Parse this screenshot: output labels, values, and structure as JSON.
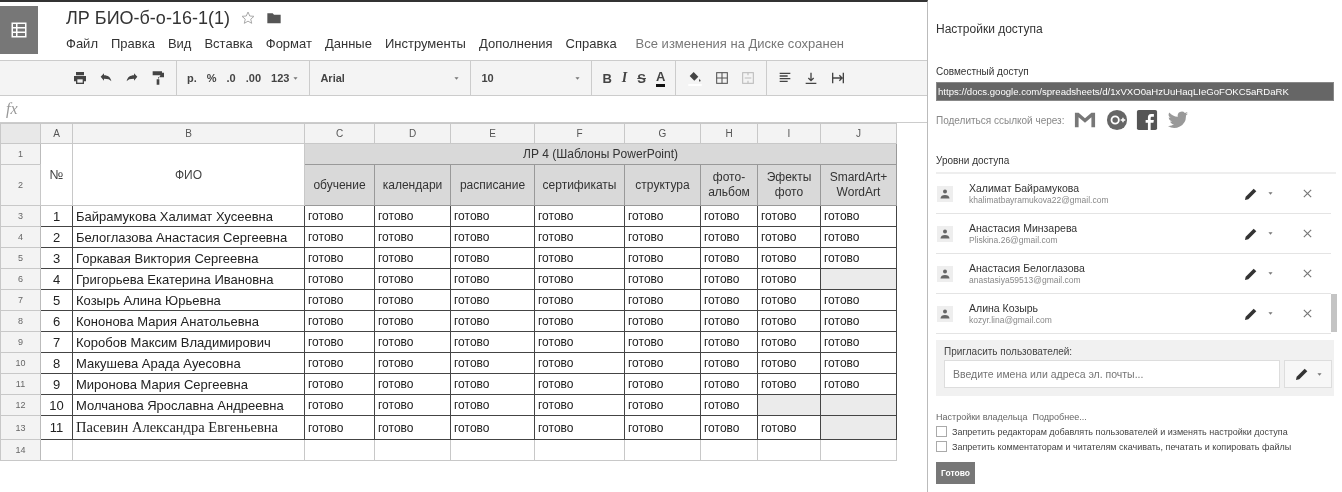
{
  "sheet": {
    "title": "ЛР БИО-б-о-16-1(1)",
    "menu": [
      "Файл",
      "Правка",
      "Вид",
      "Вставка",
      "Формат",
      "Данные",
      "Инструменты",
      "Дополнения",
      "Справка"
    ],
    "save_status": "Все изменения на Диске сохранен",
    "toolbar": {
      "currency": "р.",
      "percent": "%",
      "decimal_less": ".0",
      "decimal_more": ".00",
      "number_format": "123",
      "font": "Arial",
      "font_size": "10",
      "bold": "B",
      "italic": "I",
      "strike": "S",
      "text_color": "A"
    },
    "formula_label": "fx",
    "columns": [
      "A",
      "B",
      "C",
      "D",
      "E",
      "F",
      "G",
      "H",
      "I",
      "J"
    ],
    "header": {
      "row_numbers": [
        "1",
        "2"
      ],
      "number": "№",
      "name": "ФИО",
      "group": "ЛР 4 (Шаблоны PowerPoint)",
      "subcolumns": [
        "обучение",
        "календари",
        "расписание",
        "сертификаты",
        "структура",
        "фото-альбом",
        "Эфекты фото",
        "SmardArt+ WordArt"
      ]
    },
    "rows": [
      {
        "row_number": "3",
        "number": "1",
        "name": "Байрамукова Халимат Хусеевна",
        "cells": [
          "готово",
          "готово",
          "готово",
          "готово",
          "готово",
          "готово",
          "готово",
          "готово"
        ]
      },
      {
        "row_number": "4",
        "number": "2",
        "name": "Белоглазова Анастасия Сергеевна",
        "cells": [
          "готово",
          "готово",
          "готово",
          "готово",
          "готово",
          "готово",
          "готово",
          "готово"
        ]
      },
      {
        "row_number": "5",
        "number": "3",
        "name": "Горкавая Виктория Сергеевна",
        "cells": [
          "готово",
          "готово",
          "готово",
          "готово",
          "готово",
          "готово",
          "готово",
          "готово"
        ]
      },
      {
        "row_number": "6",
        "number": "4",
        "name": "Григорьева Екатерина Ивановна",
        "cells": [
          "готово",
          "готово",
          "готово",
          "готово",
          "готово",
          "готово",
          "готово",
          null
        ]
      },
      {
        "row_number": "7",
        "number": "5",
        "name": "Козырь Алина Юрьевна",
        "cells": [
          "готово",
          "готово",
          "готово",
          "готово",
          "готово",
          "готово",
          "готово",
          "готово"
        ]
      },
      {
        "row_number": "8",
        "number": "6",
        "name": "Кононова Мария Анатольевна",
        "cells": [
          "готово",
          "готово",
          "готово",
          "готово",
          "готово",
          "готово",
          "готово",
          "готово"
        ]
      },
      {
        "row_number": "9",
        "number": "7",
        "name": "Коробов Максим Владимирович",
        "cells": [
          "готово",
          "готово",
          "готово",
          "готово",
          "готово",
          "готово",
          "готово",
          "готово"
        ]
      },
      {
        "row_number": "10",
        "number": "8",
        "name": "Макушева Арада Ауесовна",
        "cells": [
          "готово",
          "готово",
          "готово",
          "готово",
          "готово",
          "готово",
          "готово",
          "готово"
        ]
      },
      {
        "row_number": "11",
        "number": "9",
        "name": "Миронова Мария Сергеевна",
        "cells": [
          "готово",
          "готово",
          "готово",
          "готово",
          "готово",
          "готово",
          "готово",
          "готово"
        ]
      },
      {
        "row_number": "12",
        "number": "10",
        "name": "Молчанова Ярославна Андреевна",
        "cells": [
          "готово",
          "готово",
          "готово",
          "готово",
          "готово",
          "готово",
          null,
          null
        ]
      },
      {
        "row_number": "13",
        "number": "11",
        "name": "Пасевин Александра Евгеньевна",
        "serif": true,
        "cells": [
          "готово",
          "готово",
          "готово",
          "готово",
          "готово",
          "готово",
          "готово",
          null
        ]
      },
      {
        "row_number": "14"
      }
    ]
  },
  "sharing": {
    "title": "Настройки доступа",
    "link_label": "Совместный доступ",
    "link": "https://docs.google.com/spreadsheets/d/1xVXO0aHzUuHaqLIeGoFOKC5aRDaRK",
    "share_via": "Поделиться ссылкой через:",
    "access_label": "Уровни доступа",
    "people": [
      {
        "name": "Халимат Байрамукова",
        "email": "khalimatbayramukova22@gmail.com"
      },
      {
        "name": "Анастасия Минзарева",
        "email": "Pliskina.26@gmail.com"
      },
      {
        "name": "Анастасия Белоглазова",
        "email": "anastasiya59513@gmail.com"
      },
      {
        "name": "Алина Козырь",
        "email": "kozyr.lina@gmail.com"
      }
    ],
    "invite_label": "Пригласить пользователей:",
    "invite_placeholder": "Введите имена или адреса эл. почты...",
    "owner_label": "Настройки владельца",
    "owner_link": "Подробнее...",
    "options": [
      {
        "label": "Запретить редакторам добавлять пользователей и изменять настройки доступа",
        "checked": false
      },
      {
        "label": "Запретить комментаторам и читателям скачивать, печатать и копировать файлы",
        "checked": false
      }
    ],
    "done_button": "Готово"
  }
}
